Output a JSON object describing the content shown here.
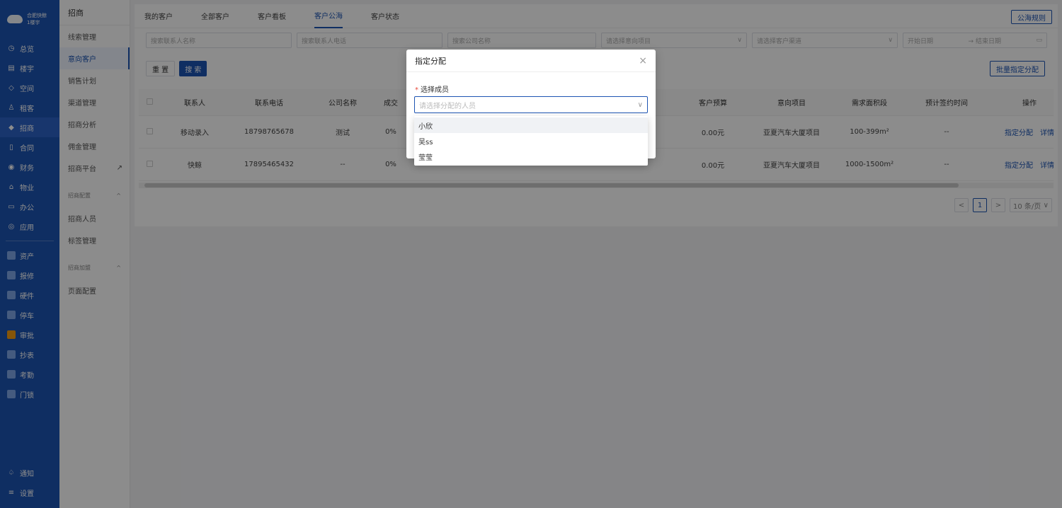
{
  "brand": {
    "name": "合肥快鲸",
    "building": "1楼宇"
  },
  "nav": {
    "main": [
      {
        "label": "总览",
        "icon": "clock-icon"
      },
      {
        "label": "楼宇",
        "icon": "building-icon"
      },
      {
        "label": "空间",
        "icon": "cube-icon"
      },
      {
        "label": "租客",
        "icon": "user-icon"
      },
      {
        "label": "招商",
        "icon": "tag-icon",
        "active": true
      },
      {
        "label": "合同",
        "icon": "document-icon"
      },
      {
        "label": "财务",
        "icon": "coin-icon"
      },
      {
        "label": "物业",
        "icon": "home-icon"
      },
      {
        "label": "办公",
        "icon": "monitor-icon"
      },
      {
        "label": "应用",
        "icon": "app-icon"
      }
    ],
    "apps": [
      {
        "label": "资产"
      },
      {
        "label": "报修"
      },
      {
        "label": "硬件"
      },
      {
        "label": "停车"
      },
      {
        "label": "审批",
        "orange": true
      },
      {
        "label": "抄表"
      },
      {
        "label": "考勤"
      },
      {
        "label": "门锁"
      }
    ],
    "bottom": [
      {
        "label": "通知",
        "icon": "bell-icon"
      },
      {
        "label": "设置",
        "icon": "menu-icon"
      }
    ]
  },
  "subnav": {
    "title": "招商",
    "items": [
      "线索管理",
      "意向客户",
      "销售计划",
      "渠道管理",
      "招商分析",
      "佣金管理",
      "招商平台"
    ],
    "group1": "招商配置",
    "group1_items": [
      "招商人员",
      "标签管理"
    ],
    "group2": "招商加盟",
    "group2_items": [
      "页面配置"
    ]
  },
  "tabs": [
    "我的客户",
    "全部客户",
    "客户看板",
    "客户公海",
    "客户状态"
  ],
  "rule_button": "公海规则",
  "filters": {
    "contact_name": "搜索联系人名称",
    "contact_phone": "搜索联系人电话",
    "company": "搜索公司名称",
    "project": "请选择意向项目",
    "channel": "请选择客户渠道",
    "start_date": "开始日期",
    "end_date": "结束日期",
    "arrow": "→"
  },
  "buttons": {
    "reset": "重 置",
    "search": "搜 索",
    "batch": "批量指定分配"
  },
  "table": {
    "headers": [
      "联系人",
      "联系电话",
      "公司名称",
      "成交",
      "客户预算",
      "意向项目",
      "需求面积段",
      "预计签约时间",
      "操作"
    ],
    "rows": [
      {
        "contact": "移动录入",
        "phone": "18798765678",
        "company": "测试",
        "deal": "0%",
        "budget": "0.00元",
        "project": "亚夏汽车大厦项目",
        "area": "100-399m²",
        "sign": "--"
      },
      {
        "contact": "快鲸",
        "phone": "17895465432",
        "company": "--",
        "deal": "0%",
        "budget": "0.00元",
        "project": "亚夏汽车大厦项目",
        "area": "1000-1500m²",
        "sign": "--"
      }
    ],
    "action_assign": "指定分配",
    "action_detail": "详情"
  },
  "pager": {
    "prev": "<",
    "page": "1",
    "next": ">",
    "size": "10 条/页"
  },
  "modal": {
    "title": "指定分配",
    "close": "×",
    "label": "选择成员",
    "required": "*",
    "placeholder": "请选择分配的人员",
    "options": [
      "小欣",
      "吴ss",
      "莹莹"
    ]
  }
}
